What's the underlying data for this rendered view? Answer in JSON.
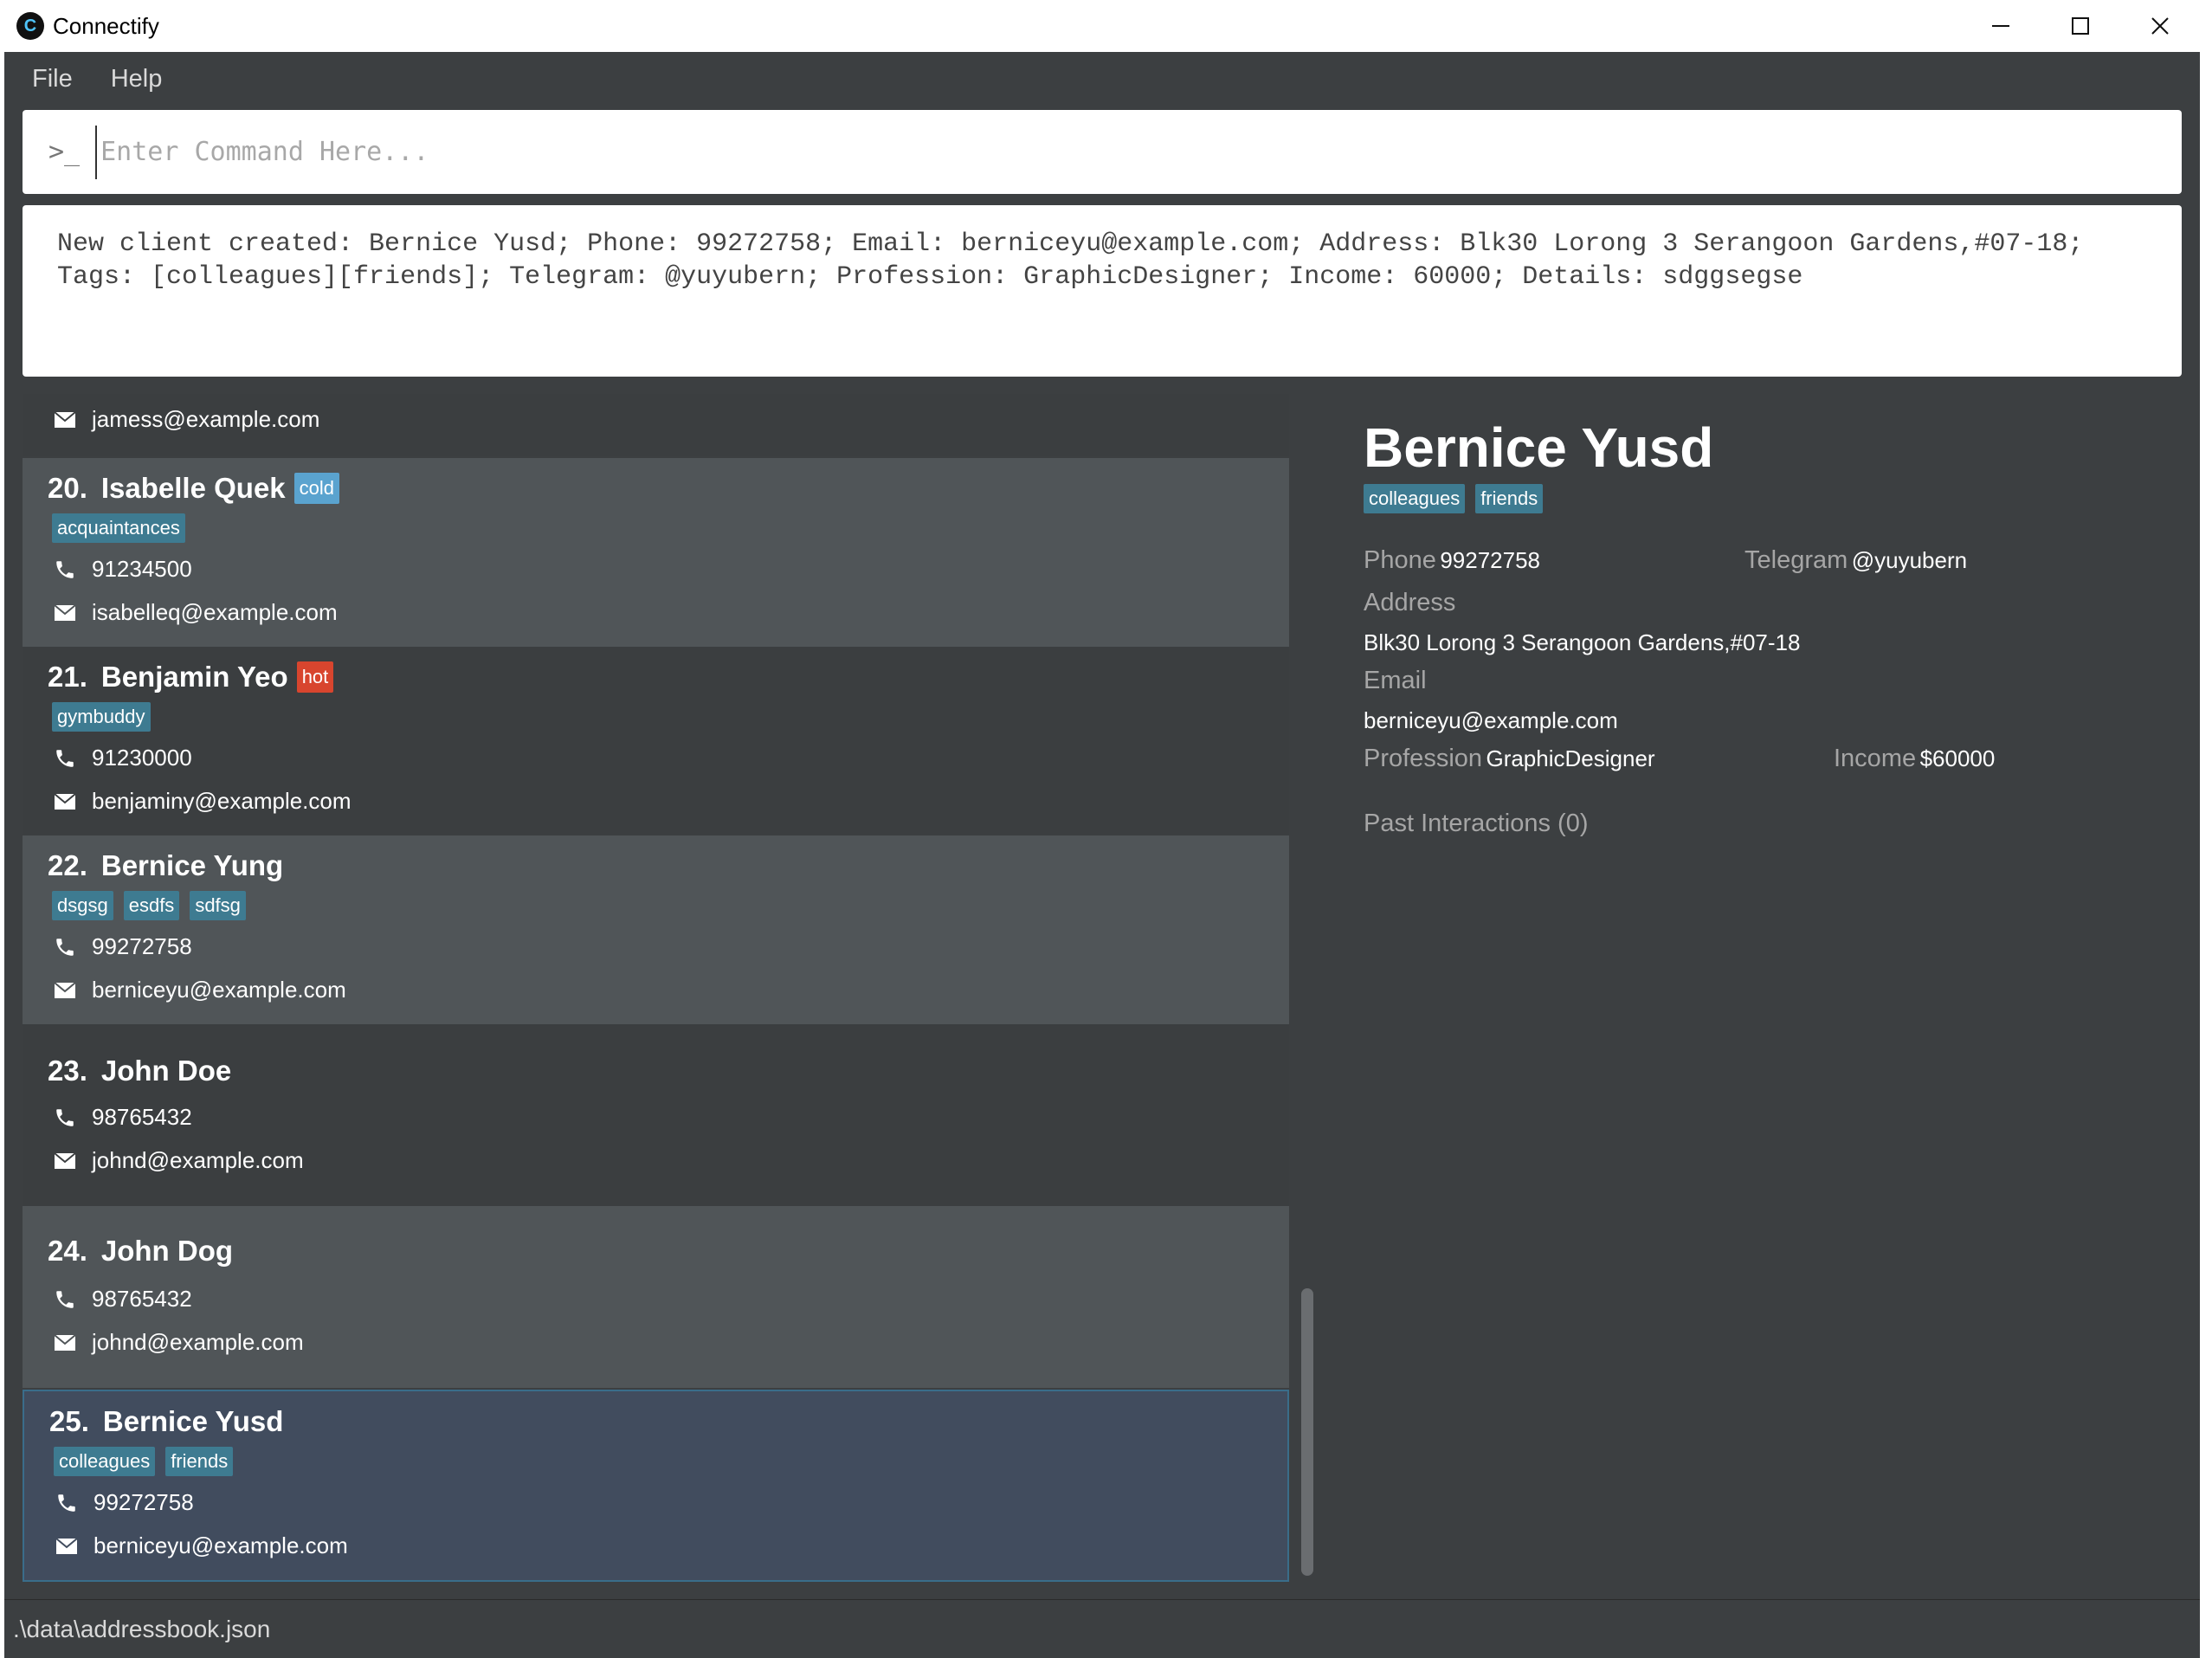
{
  "window": {
    "title": "Connectify",
    "app_icon_letter": "C"
  },
  "menu": {
    "file": "File",
    "help": "Help"
  },
  "command": {
    "placeholder": "Enter Command Here...",
    "prompt_symbol": ">_"
  },
  "result": {
    "text": "New client created: Bernice Yusd; Phone: 99272758; Email: berniceyu@example.com; Address: Blk30 Lorong 3 Serangoon Gardens,#07-18; Tags: [colleagues][friends]; Telegram: @yuyubern; Profession: GraphicDesigner; Income: 60000; Details: sdggsegse"
  },
  "clients": {
    "partial_top": {
      "email": "jamess@example.com"
    },
    "items": [
      {
        "index": "20.",
        "name": "Isabelle Quek",
        "priority": "cold",
        "tags": [
          "acquaintances"
        ],
        "phone": "91234500",
        "email": "isabelleq@example.com"
      },
      {
        "index": "21.",
        "name": "Benjamin Yeo",
        "priority": "hot",
        "tags": [
          "gymbuddy"
        ],
        "phone": "91230000",
        "email": "benjaminy@example.com"
      },
      {
        "index": "22.",
        "name": "Bernice Yung",
        "priority": "",
        "tags": [
          "dsgsg",
          "esdfs",
          "sdfsg"
        ],
        "phone": "99272758",
        "email": "berniceyu@example.com"
      },
      {
        "index": "23.",
        "name": "John Doe",
        "priority": "",
        "tags": [],
        "phone": "98765432",
        "email": "johnd@example.com"
      },
      {
        "index": "24.",
        "name": "John Dog",
        "priority": "",
        "tags": [],
        "phone": "98765432",
        "email": "johnd@example.com"
      },
      {
        "index": "25.",
        "name": "Bernice Yusd",
        "priority": "",
        "tags": [
          "colleagues",
          "friends"
        ],
        "phone": "99272758",
        "email": "berniceyu@example.com"
      }
    ]
  },
  "detail": {
    "name": "Bernice Yusd",
    "tags": [
      "colleagues",
      "friends"
    ],
    "phone_label": "Phone",
    "phone": "99272758",
    "telegram_label": "Telegram",
    "telegram": "@yuyubern",
    "address_label": "Address",
    "address": "Blk30 Lorong 3 Serangoon Gardens,#07-18",
    "email_label": "Email",
    "email": "berniceyu@example.com",
    "profession_label": "Profession",
    "profession": "GraphicDesigner",
    "income_label": "Income",
    "income": "$60000",
    "past_interactions": "Past Interactions (0)"
  },
  "status": {
    "path": ".\\data\\addressbook.json"
  },
  "colors": {
    "background": "#3c3f41",
    "tag": "#3e7b91",
    "priority_cold": "#5aa3cf",
    "priority_hot": "#d8452e",
    "selected_card": "#414c5e"
  },
  "icons": {
    "phone": "phone-icon",
    "email": "envelope-icon",
    "minimize": "minimize-icon",
    "maximize": "maximize-icon",
    "close": "close-icon",
    "prompt": "terminal-prompt-icon"
  }
}
